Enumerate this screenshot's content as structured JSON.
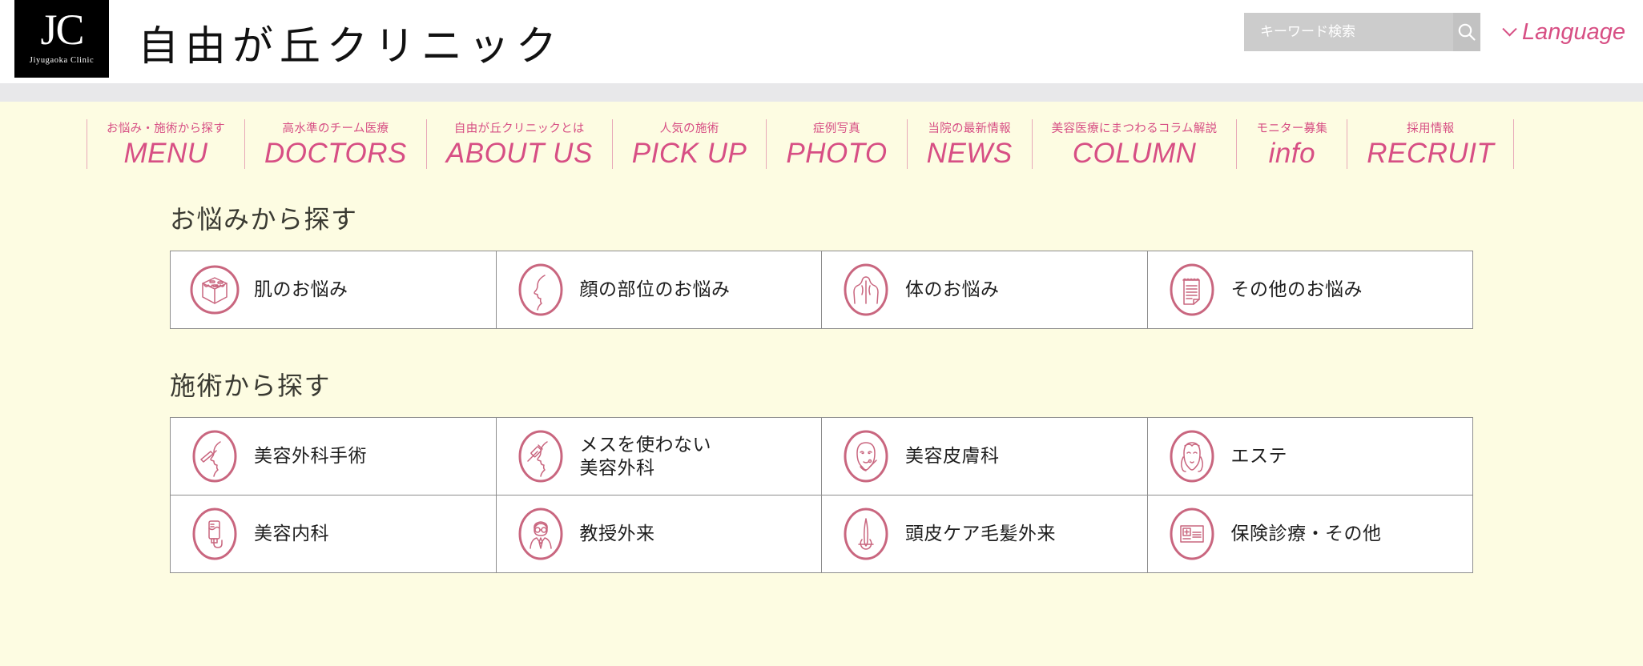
{
  "header": {
    "logo_initials": "JC",
    "logo_subtitle": "Jiyugaoka Clinic",
    "site_title": "自由が丘クリニック",
    "search": {
      "placeholder": "キーワード検索",
      "value": "",
      "icon": "search-icon"
    },
    "language": {
      "label": "Language",
      "icon": "chevron-down-icon"
    },
    "accent_color": "#d74f84"
  },
  "nav": {
    "items": [
      {
        "ja": "お悩み・施術から探す",
        "en": "MENU"
      },
      {
        "ja": "高水準のチーム医療",
        "en": "DOCTORS"
      },
      {
        "ja": "自由が丘クリニックとは",
        "en": "ABOUT US"
      },
      {
        "ja": "人気の施術",
        "en": "PICK UP"
      },
      {
        "ja": "症例写真",
        "en": "PHOTO"
      },
      {
        "ja": "当院の最新情報",
        "en": "NEWS"
      },
      {
        "ja": "美容医療にまつわるコラム解説",
        "en": "COLUMN"
      },
      {
        "ja": "モニター募集",
        "en": "info"
      },
      {
        "ja": "採用情報",
        "en": "RECRUIT"
      }
    ]
  },
  "main": {
    "sections": [
      {
        "title": "お悩みから探す",
        "cards": [
          {
            "label": "肌のお悩み",
            "icon": "skin-cube-icon"
          },
          {
            "label": "顔の部位のお悩み",
            "icon": "face-profile-icon"
          },
          {
            "label": "体のお悩み",
            "icon": "body-torso-icon"
          },
          {
            "label": "その他のお悩み",
            "icon": "notepad-icon"
          }
        ]
      },
      {
        "title": "施術から探す",
        "cards": [
          {
            "label": "美容外科手術",
            "icon": "scalpel-face-icon"
          },
          {
            "label": "メスを使わない\n美容外科",
            "icon": "syringe-face-icon"
          },
          {
            "label": "美容皮膚科",
            "icon": "face-treatment-icon"
          },
          {
            "label": "エステ",
            "icon": "facial-massage-icon"
          },
          {
            "label": "美容内科",
            "icon": "iv-drip-icon"
          },
          {
            "label": "教授外来",
            "icon": "doctor-glasses-icon"
          },
          {
            "label": "頭皮ケア毛髪外来",
            "icon": "hair-follicle-icon"
          },
          {
            "label": "保険診療・その他",
            "icon": "insurance-card-icon"
          }
        ]
      }
    ]
  },
  "colors": {
    "page_background": "#fdfce2",
    "card_background": "#ffffff",
    "icon_stroke": "#c9667f",
    "divider": "#8d8d8d",
    "gray_strip": "#e8e8ea"
  }
}
